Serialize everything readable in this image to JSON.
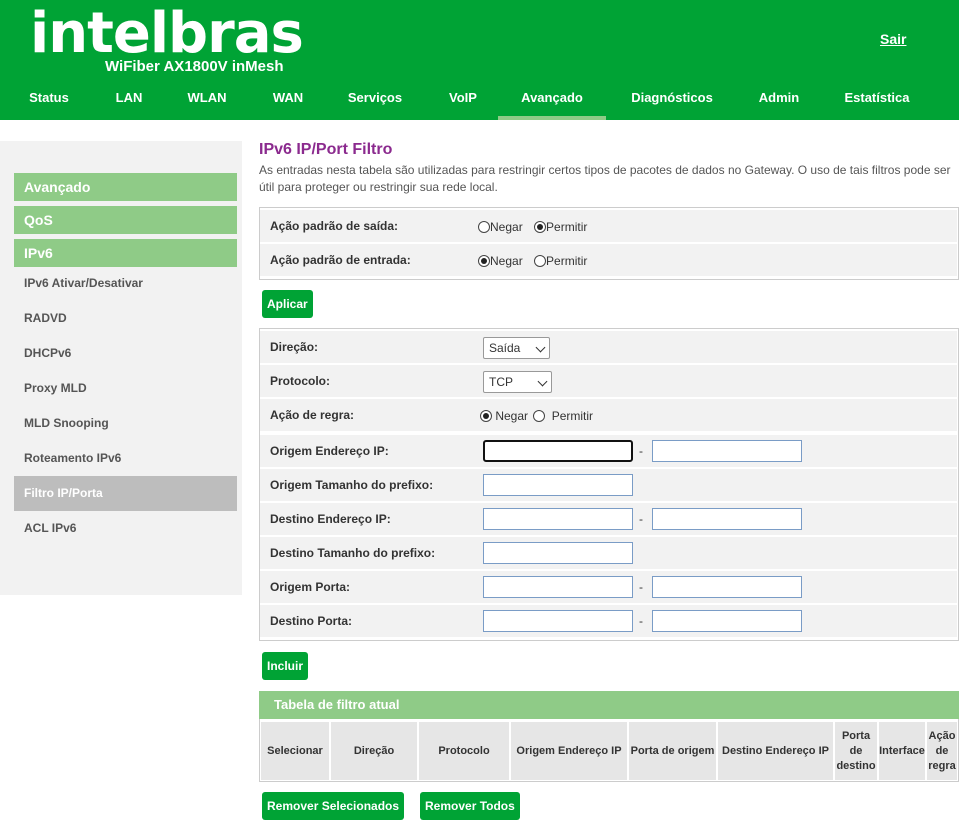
{
  "header": {
    "logo": "intelbras",
    "model": "WiFiber AX1800V inMesh",
    "logout": "Sair",
    "nav": [
      "Status",
      "LAN",
      "WLAN",
      "WAN",
      "Serviços",
      "VoIP",
      "Avançado",
      "Diagnósticos",
      "Admin",
      "Estatística"
    ],
    "active_nav": "Avançado"
  },
  "sidebar": {
    "groups": [
      "Avançado",
      "QoS",
      "IPv6"
    ],
    "items": [
      "IPv6 Ativar/Desativar",
      "RADVD",
      "DHCPv6",
      "Proxy MLD",
      "MLD Snooping",
      "Roteamento IPv6",
      "Filtro IP/Porta",
      "ACL IPv6"
    ],
    "active_item": "Filtro IP/Porta"
  },
  "page": {
    "title": "IPv6 IP/Port Filtro",
    "description": "As entradas nesta tabela são utilizadas para restringir certos tipos de pacotes de dados no Gateway. O uso de tais filtros pode ser útil para proteger ou restringir sua rede local."
  },
  "defaults": {
    "outgoing_label": "Ação padrão de saída:",
    "incoming_label": "Ação padrão de entrada:",
    "deny": "Negar",
    "allow": "Permitir",
    "outgoing_value": "Permitir",
    "incoming_value": "Negar",
    "apply_button": "Aplicar"
  },
  "rule_form": {
    "direction_label": "Direção:",
    "direction_value": "Saída",
    "protocol_label": "Protocolo:",
    "protocol_value": "TCP",
    "rule_action_label": "Ação de regra:",
    "rule_action_value": "Negar",
    "src_ip_label": "Origem Endereço IP:",
    "src_prefix_label": "Origem Tamanho do prefixo:",
    "dst_ip_label": "Destino Endereço IP:",
    "dst_prefix_label": "Destino Tamanho do prefixo:",
    "src_port_label": "Origem Porta:",
    "dst_port_label": "Destino Porta:",
    "range_separator": "-",
    "include_button": "Incluir"
  },
  "filter_table": {
    "title": "Tabela de filtro atual",
    "columns": [
      "Selecionar",
      "Direção",
      "Protocolo",
      "Origem Endereço IP",
      "Porta de origem",
      "Destino Endereço IP",
      "Porta de destino",
      "Interface",
      "Ação de regra"
    ],
    "remove_selected": "Remover Selecionados",
    "remove_all": "Remover Todos"
  }
}
